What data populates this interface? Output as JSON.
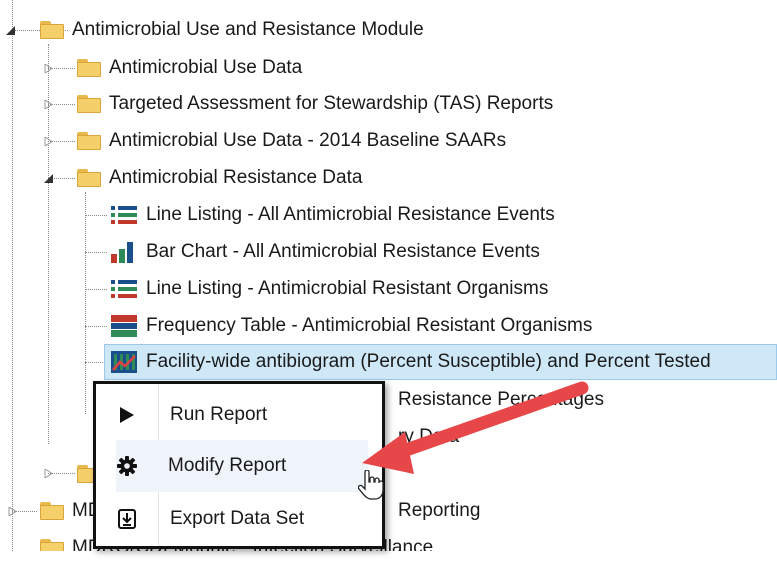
{
  "tree": {
    "module_label": "Antimicrobial Use and Resistance Module",
    "children": [
      {
        "label": "Antimicrobial Use Data"
      },
      {
        "label": "Targeted Assessment for Stewardship (TAS) Reports"
      },
      {
        "label": "Antimicrobial Use Data - 2014 Baseline SAARs"
      },
      {
        "label": "Antimicrobial Resistance Data"
      }
    ],
    "reports": [
      {
        "label": "Line Listing - All Antimicrobial Resistance Events",
        "icon": "line-listing-icon"
      },
      {
        "label": "Bar Chart - All Antimicrobial Resistance Events",
        "icon": "bar-chart-icon"
      },
      {
        "label": "Line Listing - Antimicrobial Resistant Organisms",
        "icon": "line-listing-icon"
      },
      {
        "label": "Frequency Table - Antimicrobial Resistant Organisms",
        "icon": "frequency-table-icon"
      },
      {
        "label": "Facility-wide antibiogram (Percent Susceptible) and Percent Tested",
        "icon": "antibiogram-icon"
      }
    ],
    "partial_rows": {
      "resistance_text": "Resistance Percentages",
      "data_text": "ry Data",
      "reporting_text": "Reporting",
      "mdro_label_1": "MD",
      "mdro_label_2": "MDRO/CDI Module - Infection Surveillance"
    }
  },
  "context_menu": {
    "items": [
      {
        "label": "Run Report",
        "icon": "play-icon"
      },
      {
        "label": "Modify Report",
        "icon": "gear-icon"
      },
      {
        "label": "Export Data Set",
        "icon": "download-icon"
      }
    ]
  },
  "colors": {
    "selection": "#cfe8f8",
    "arrow": "#e8474a"
  }
}
